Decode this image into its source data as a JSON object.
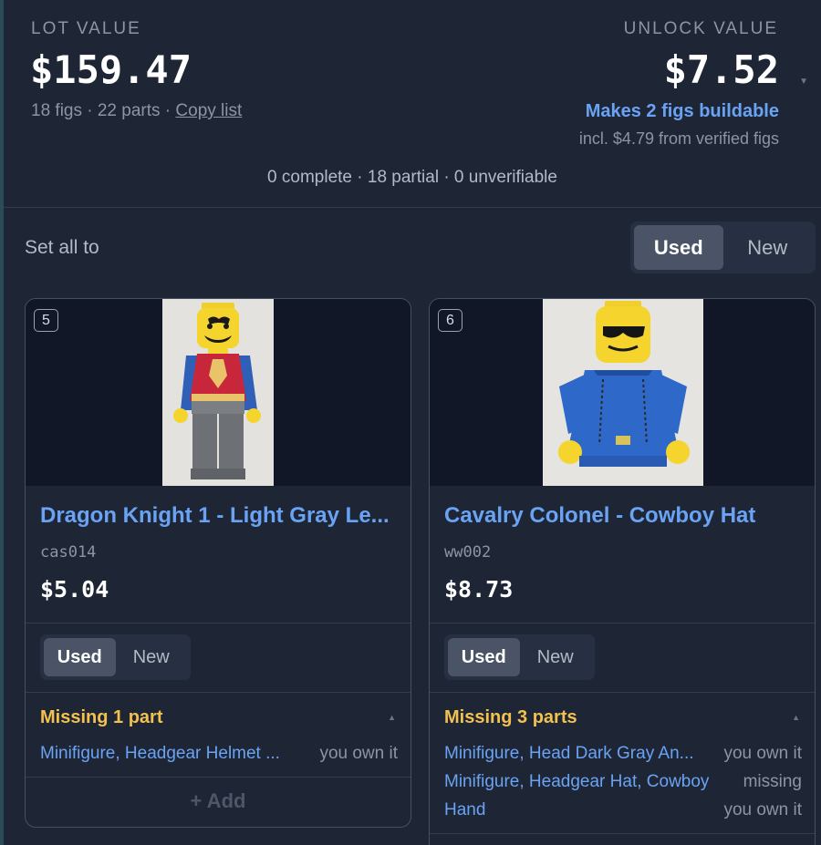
{
  "summary": {
    "lot_label": "LOT VALUE",
    "lot_value": "$159.47",
    "lot_meta": "18 figs · 22 parts · ",
    "copy_list": "Copy list",
    "unlock_label": "UNLOCK VALUE",
    "unlock_value": "$7.52",
    "buildable": "Makes 2 figs buildable",
    "incl": "incl. $4.79 from verified figs",
    "counts": "0 complete · 18 partial · 0 unverifiable"
  },
  "set_all": {
    "label": "Set all to",
    "options": [
      "Used",
      "New"
    ],
    "selected": "Used"
  },
  "cards": [
    {
      "badge": "5",
      "name": "Dragon Knight 1 - Light Gray Le...",
      "code": "cas014",
      "price": "$5.04",
      "condition_options": [
        "Used",
        "New"
      ],
      "condition_selected": "Used",
      "missing": "Missing 1 part",
      "parts": [
        {
          "name": "Minifigure, Headgear Helmet ...",
          "status": "you own it"
        }
      ],
      "add_label": "+ Add"
    },
    {
      "badge": "6",
      "name": "Cavalry Colonel - Cowboy Hat",
      "code": "ww002",
      "price": "$8.73",
      "condition_options": [
        "Used",
        "New"
      ],
      "condition_selected": "Used",
      "missing": "Missing 3 parts",
      "parts": [
        {
          "name": "Minifigure, Head Dark Gray An...",
          "status": "you own it"
        },
        {
          "name": "Minifigure, Headgear Hat, Cowboy",
          "status": "missing"
        },
        {
          "name": "Hand",
          "status": "you own it"
        }
      ]
    }
  ],
  "colors": {
    "background": "#1e2636",
    "accent_blue": "#6aa3f4",
    "warning_yellow": "#f2c14e",
    "muted_text": "#8d95a3",
    "segment_active": "#4a5466"
  },
  "icons": {
    "summary_expand": "chevron-down-icon",
    "missing_collapse": "caret-up-icon"
  }
}
